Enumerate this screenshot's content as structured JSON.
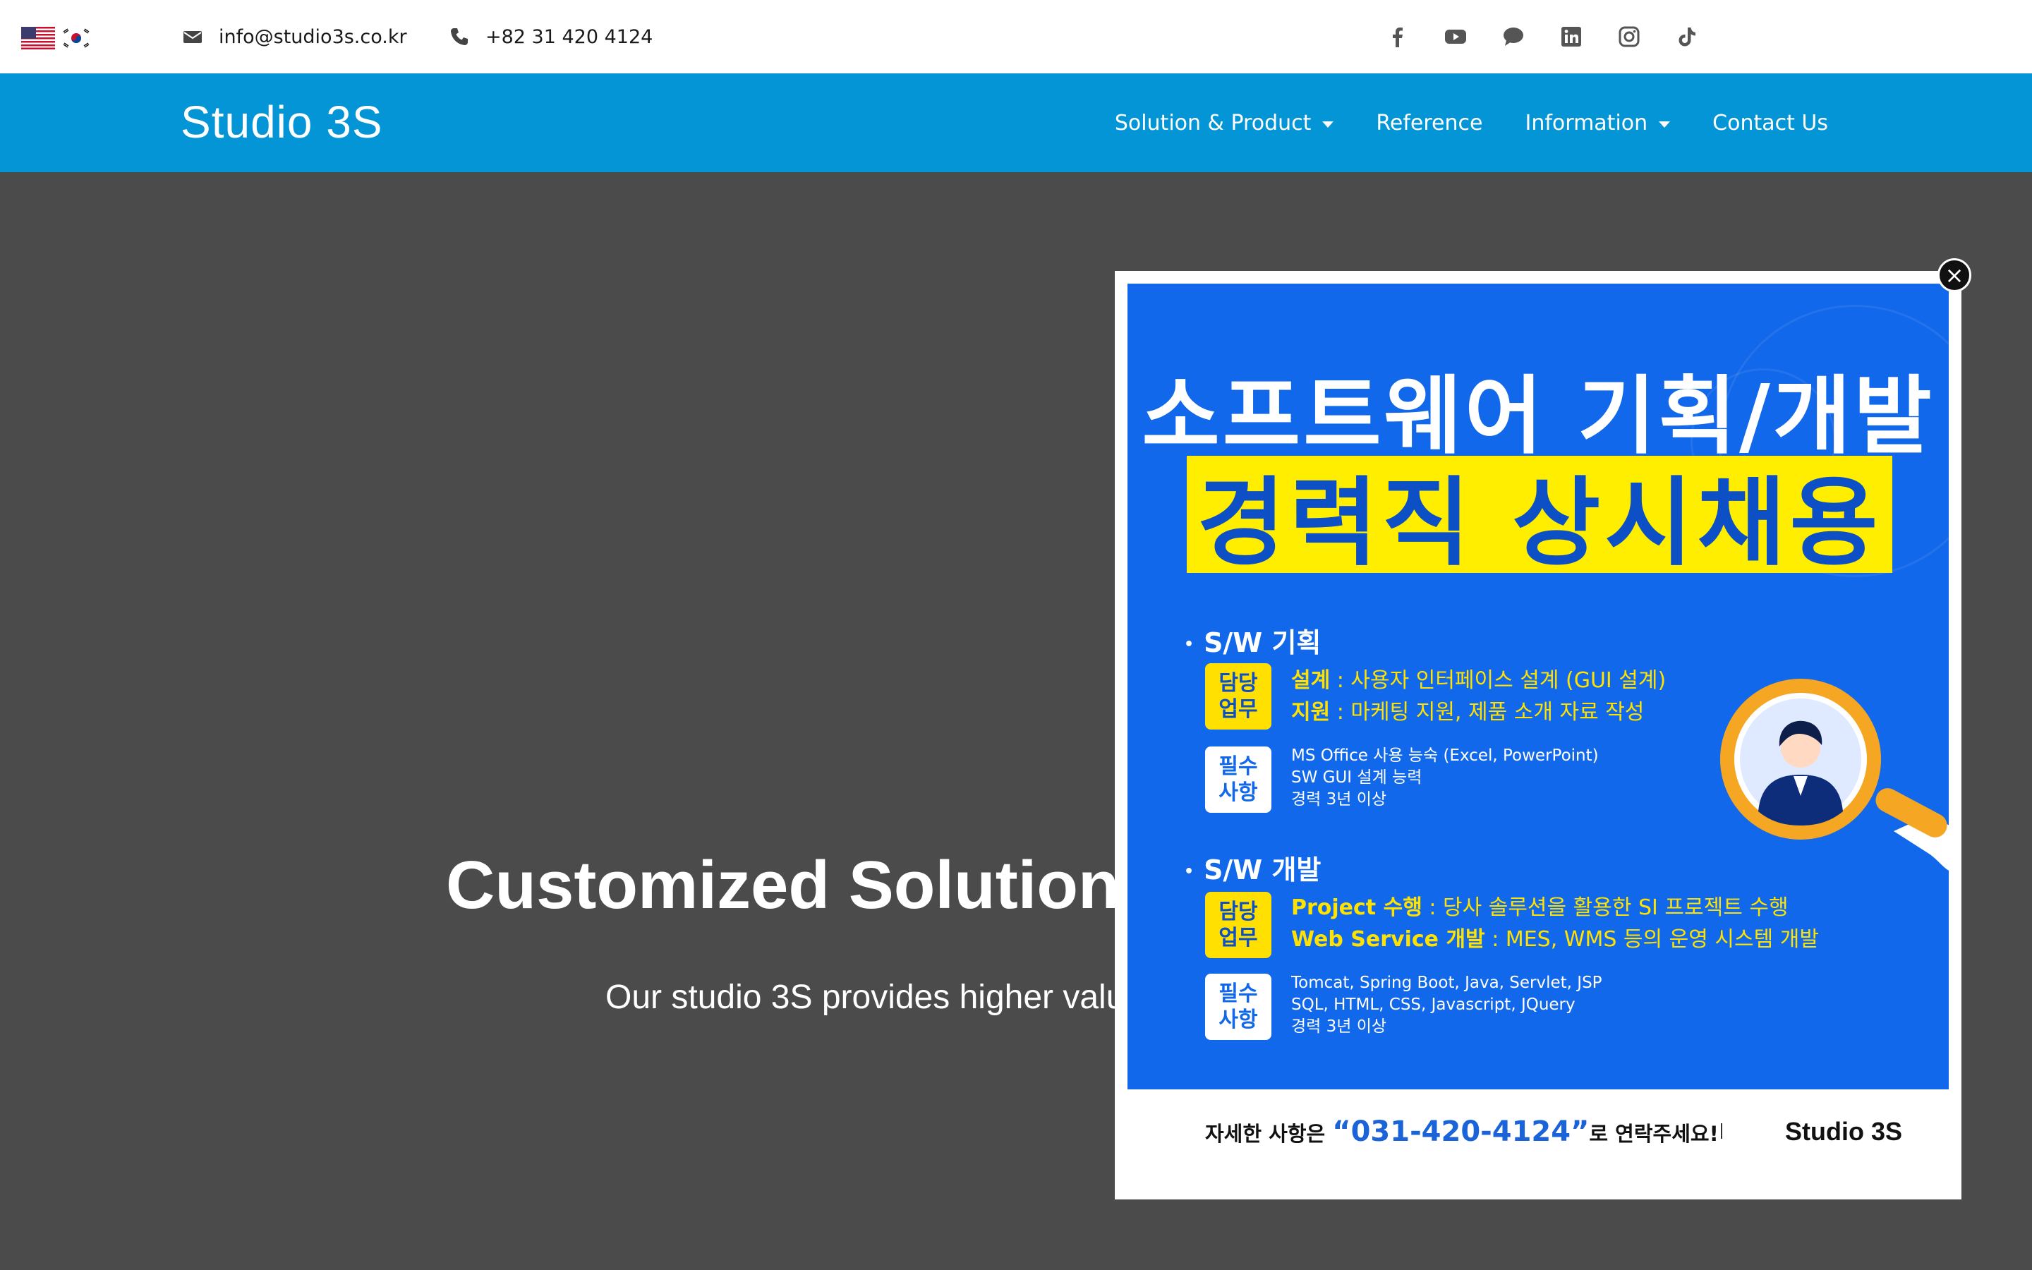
{
  "topbar": {
    "email": "info@studio3s.co.kr",
    "phone": "+82 31 420 4124",
    "languages": [
      "en-flag-icon",
      "kr-flag-icon"
    ],
    "social": [
      "facebook-icon",
      "youtube-icon",
      "chat-icon",
      "linkedin-icon",
      "instagram-icon",
      "tiktok-icon"
    ]
  },
  "nav": {
    "logo": "Studio 3S",
    "items": [
      {
        "label": "Solution & Product",
        "dropdown": true
      },
      {
        "label": "Reference",
        "dropdown": false
      },
      {
        "label": "Information",
        "dropdown": true
      },
      {
        "label": "Contact Us",
        "dropdown": false
      }
    ]
  },
  "hero": {
    "title": "Customized Solutions",
    "subtitle": "Our studio 3S provides higher valu"
  },
  "popup": {
    "heading1": "소프트웨어 기획/개발",
    "heading2": "경력직 상시채용",
    "sections": [
      {
        "title": "S/W 기획",
        "duty_badge": [
          "담당",
          "업무"
        ],
        "duties": [
          {
            "label": "설계",
            "text": " : 사용자 인터페이스 설계 (GUI 설계)"
          },
          {
            "label": "지원",
            "text": " : 마케팅 지원, 제품 소개 자료 작성"
          }
        ],
        "req_badge": [
          "필수",
          "사항"
        ],
        "requirements": [
          "MS Office 사용 능숙 (Excel, PowerPoint)",
          "SW GUI 설계 능력",
          "경력 3년 이상"
        ]
      },
      {
        "title": "S/W 개발",
        "duty_badge": [
          "담당",
          "업무"
        ],
        "duties": [
          {
            "label": "Project 수행",
            "text": " : 당사 솔루션을 활용한 SI 프로젝트 수행"
          },
          {
            "label": "Web Service 개발",
            "text": " : MES, WMS 등의 운영 시스템 개발"
          }
        ],
        "req_badge": [
          "필수",
          "사항"
        ],
        "requirements": [
          "Tomcat, Spring Boot, Java, Servlet, JSP",
          "SQL, HTML, CSS, Javascript, JQuery",
          "경력 3년 이상"
        ]
      }
    ],
    "footer": {
      "prefix": "자세한 사항은 ",
      "phone": "“031-420-4124”",
      "suffix": "로 연락주세요!",
      "logo": "Studio 3S"
    },
    "close": "×"
  },
  "colors": {
    "nav_bg": "#0495d6",
    "hero_bg": "#4b4b4b",
    "poster_bg": "#1268ea",
    "poster_yellow": "#ffee00"
  }
}
